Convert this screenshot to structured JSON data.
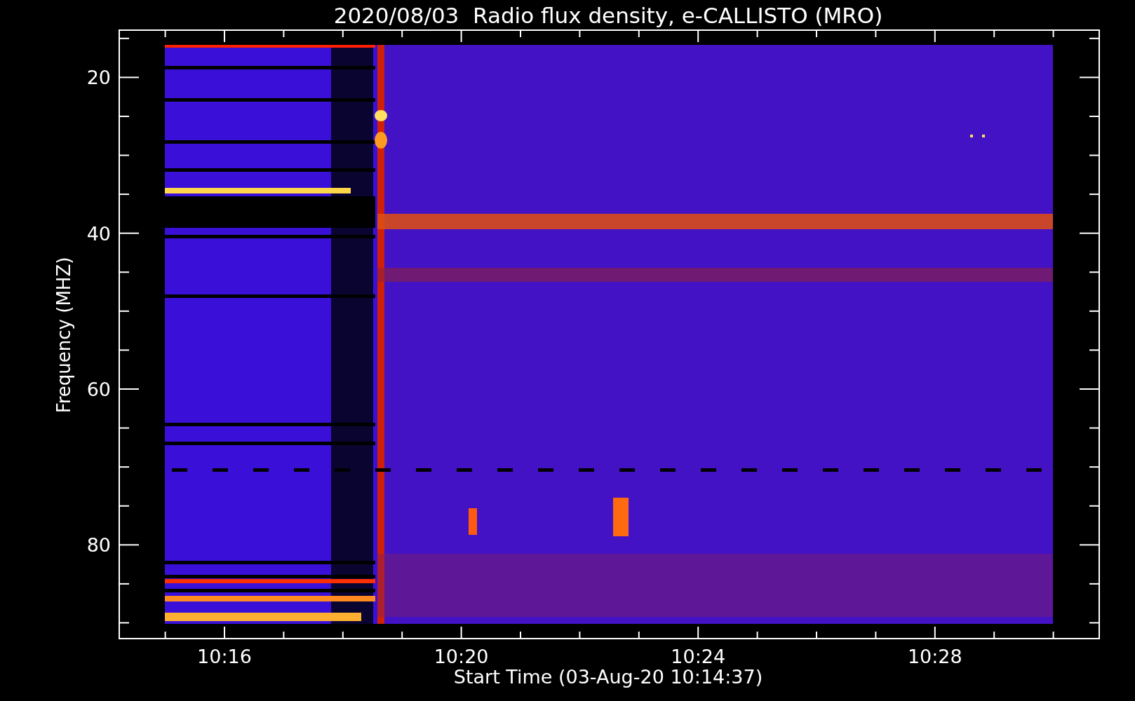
{
  "title": "2020/08/03  Radio flux density, e-CALLISTO (MRO)",
  "y_axis": {
    "label": "Frequency (MHZ)",
    "ticks": [
      "20",
      "40",
      "60",
      "80"
    ]
  },
  "x_axis": {
    "label": "Start Time (03-Aug-20 10:14:37)",
    "ticks": [
      "10:16",
      "10:20",
      "10:24",
      "10:28"
    ]
  }
}
